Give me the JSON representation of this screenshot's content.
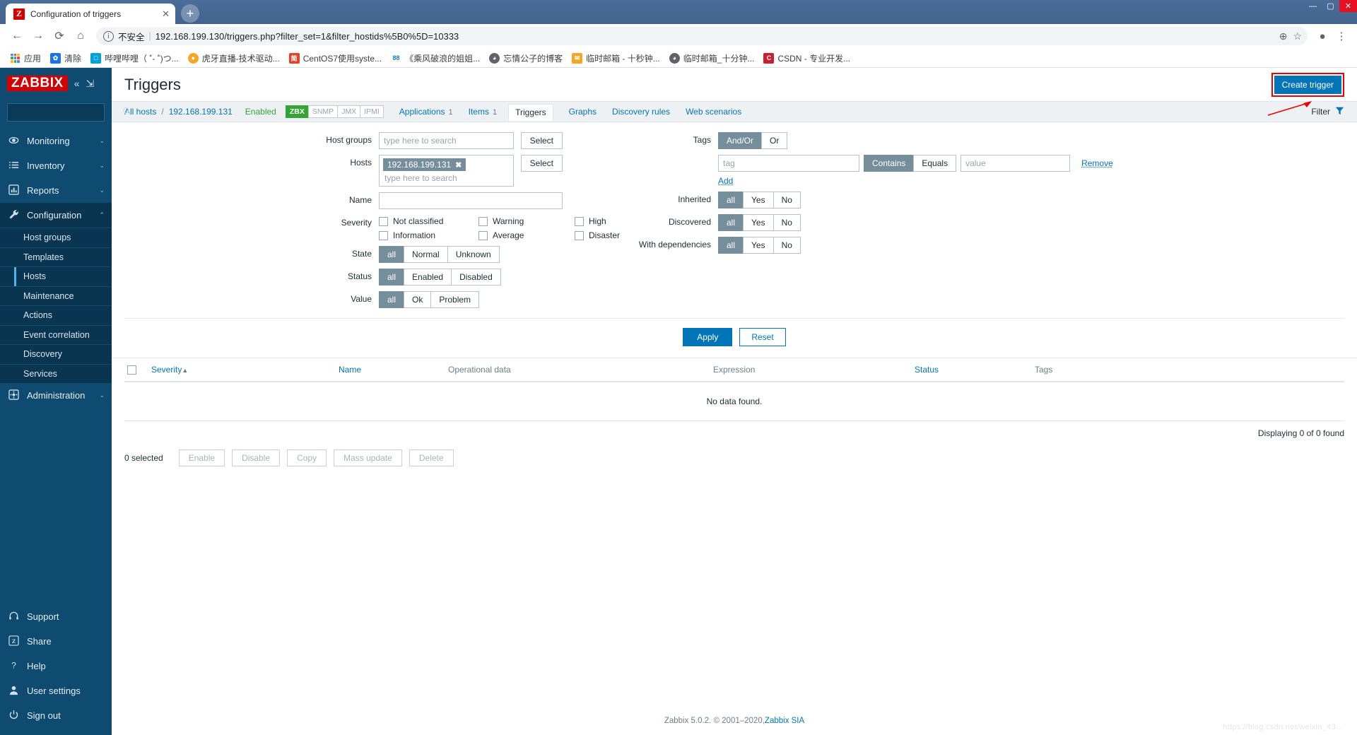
{
  "browser": {
    "tab": {
      "title": "Configuration of triggers",
      "favicon_letter": "Z",
      "close_icon": "✕"
    },
    "new_tab_label": "+",
    "window_controls": {
      "minimize": "—",
      "maximize": "▢",
      "close": "✕"
    },
    "nav": {
      "back": "←",
      "forward": "→",
      "reload": "⟳",
      "home": "⌂"
    },
    "omnibox": {
      "info_icon": "i",
      "security_label": "不安全",
      "url": "192.168.199.130/triggers.php?filter_set=1&filter_hostids%5B0%5D=10333",
      "zoom_icon": "⊕",
      "star_icon": "☆",
      "profile_icon": "●",
      "menu_icon": "⋮"
    },
    "bookmarks": [
      {
        "label": "应用",
        "icon_type": "apps-grid",
        "color": "#4285f4"
      },
      {
        "label": "清除",
        "icon_type": "gear",
        "color": "#1a73e8",
        "glyph": "✿"
      },
      {
        "label": "哔哩哔哩（ ˚- ˚)つ...",
        "icon_type": "square",
        "color": "#00a1d6",
        "glyph": "□"
      },
      {
        "label": "虎牙直播-技术驱动...",
        "icon_type": "circle",
        "color": "#f5a623",
        "glyph": "●"
      },
      {
        "label": "CentOS7使用syste...",
        "icon_type": "square",
        "color": "#e24329",
        "glyph": "简"
      },
      {
        "label": "《乘风破浪的姐姐...",
        "icon_type": "text",
        "color": "#1a73e8",
        "glyph": "88"
      },
      {
        "label": "忘情公子的博客",
        "icon_type": "circle",
        "color": "#5f6368",
        "glyph": "◕"
      },
      {
        "label": "临时邮箱 - 十秒钟...",
        "icon_type": "square",
        "color": "#f5a623",
        "glyph": "✉"
      },
      {
        "label": "临时邮箱_十分钟...",
        "icon_type": "circle",
        "color": "#5f6368",
        "glyph": "◕"
      },
      {
        "label": "CSDN - 专业开发...",
        "icon_type": "square",
        "color": "#c8202e",
        "glyph": "C"
      }
    ]
  },
  "sidebar": {
    "logo": "ZABBIX",
    "collapse_icon": "«",
    "hide_icon": "⇲",
    "search_placeholder": "",
    "search_value": "",
    "search_icon": "search-icon",
    "nav": [
      {
        "label": "Monitoring",
        "icon": "eye-icon",
        "chevron": "⌄",
        "active": false
      },
      {
        "label": "Inventory",
        "icon": "list-icon",
        "chevron": "⌄",
        "active": false
      },
      {
        "label": "Reports",
        "icon": "chart-icon",
        "chevron": "⌄",
        "active": false
      },
      {
        "label": "Configuration",
        "icon": "wrench-icon",
        "chevron": "⌃",
        "active": true
      },
      {
        "label": "Administration",
        "icon": "gear-icon",
        "chevron": "⌄",
        "active": false
      }
    ],
    "config_submenu": [
      {
        "label": "Host groups",
        "current": false
      },
      {
        "label": "Templates",
        "current": false
      },
      {
        "label": "Hosts",
        "current": true
      },
      {
        "label": "Maintenance",
        "current": false
      },
      {
        "label": "Actions",
        "current": false
      },
      {
        "label": "Event correlation",
        "current": false
      },
      {
        "label": "Discovery",
        "current": false
      },
      {
        "label": "Services",
        "current": false
      }
    ],
    "bottom": [
      {
        "label": "Support",
        "icon": "headset-icon"
      },
      {
        "label": "Share",
        "icon": "zabbix-z-icon"
      },
      {
        "label": "Help",
        "icon": "question-icon"
      },
      {
        "label": "User settings",
        "icon": "user-icon"
      },
      {
        "label": "Sign out",
        "icon": "power-icon"
      }
    ]
  },
  "header": {
    "title": "Triggers",
    "create_button": "Create trigger"
  },
  "breadcrumb": {
    "all_hosts": "All hosts",
    "separator": "/",
    "host": "192.168.199.131",
    "status": "Enabled",
    "protocols": [
      {
        "label": "ZBX",
        "on": true
      },
      {
        "label": "SNMP",
        "on": false
      },
      {
        "label": "JMX",
        "on": false
      },
      {
        "label": "IPMI",
        "on": false
      }
    ],
    "tabs": [
      {
        "label": "Applications",
        "count": "1",
        "current": false
      },
      {
        "label": "Items",
        "count": "1",
        "current": false
      },
      {
        "label": "Triggers",
        "count": "",
        "current": true
      },
      {
        "label": "Graphs",
        "count": "",
        "current": false
      },
      {
        "label": "Discovery rules",
        "count": "",
        "current": false
      },
      {
        "label": "Web scenarios",
        "count": "",
        "current": false
      }
    ],
    "filter_label": "Filter",
    "filter_icon": "funnel-icon"
  },
  "filter": {
    "host_groups": {
      "label": "Host groups",
      "placeholder": "type here to search",
      "value": "",
      "select_button": "Select"
    },
    "hosts": {
      "label": "Hosts",
      "chip": "192.168.199.131",
      "chip_remove": "✖",
      "placeholder": "type here to search",
      "select_button": "Select"
    },
    "name": {
      "label": "Name",
      "value": "",
      "placeholder": ""
    },
    "severity": {
      "label": "Severity",
      "options": [
        {
          "label": "Not classified",
          "checked": false
        },
        {
          "label": "Warning",
          "checked": false
        },
        {
          "label": "High",
          "checked": false
        },
        {
          "label": "Information",
          "checked": false
        },
        {
          "label": "Average",
          "checked": false
        },
        {
          "label": "Disaster",
          "checked": false
        }
      ]
    },
    "state": {
      "label": "State",
      "options": [
        "all",
        "Normal",
        "Unknown"
      ],
      "selected": "all"
    },
    "status": {
      "label": "Status",
      "options": [
        "all",
        "Enabled",
        "Disabled"
      ],
      "selected": "all"
    },
    "value": {
      "label": "Value",
      "options": [
        "all",
        "Ok",
        "Problem"
      ],
      "selected": "all"
    },
    "tags": {
      "label": "Tags",
      "operator_options": [
        "And/Or",
        "Or"
      ],
      "operator_selected": "And/Or",
      "tag_placeholder": "tag",
      "tag_value": "",
      "match_options": [
        "Contains",
        "Equals"
      ],
      "match_selected": "Contains",
      "value_placeholder": "value",
      "value_value": "",
      "remove_link": "Remove",
      "add_link": "Add"
    },
    "inherited": {
      "label": "Inherited",
      "options": [
        "all",
        "Yes",
        "No"
      ],
      "selected": "all"
    },
    "discovered": {
      "label": "Discovered",
      "options": [
        "all",
        "Yes",
        "No"
      ],
      "selected": "all"
    },
    "with_dependencies": {
      "label": "With dependencies",
      "options": [
        "all",
        "Yes",
        "No"
      ],
      "selected": "all"
    },
    "apply_button": "Apply",
    "reset_button": "Reset"
  },
  "table": {
    "columns": {
      "severity": "Severity",
      "sort_arrow": "▲",
      "name": "Name",
      "operational_data": "Operational data",
      "expression": "Expression",
      "status": "Status",
      "tags": "Tags"
    },
    "empty_message": "No data found.",
    "displaying": "Displaying 0 of 0 found",
    "selected_count": "0 selected",
    "actions": [
      "Enable",
      "Disable",
      "Copy",
      "Mass update",
      "Delete"
    ]
  },
  "footer": {
    "text": "Zabbix 5.0.2. © 2001–2020, ",
    "link": "Zabbix SIA",
    "watermark": "https://blog.csdn.net/weixin_43..."
  },
  "colors": {
    "brand_red": "#d40000",
    "sidebar_bg": "#0f4a71",
    "accent_blue": "#0275b8",
    "green": "#34a534",
    "highlight_red": "#ee0000"
  }
}
